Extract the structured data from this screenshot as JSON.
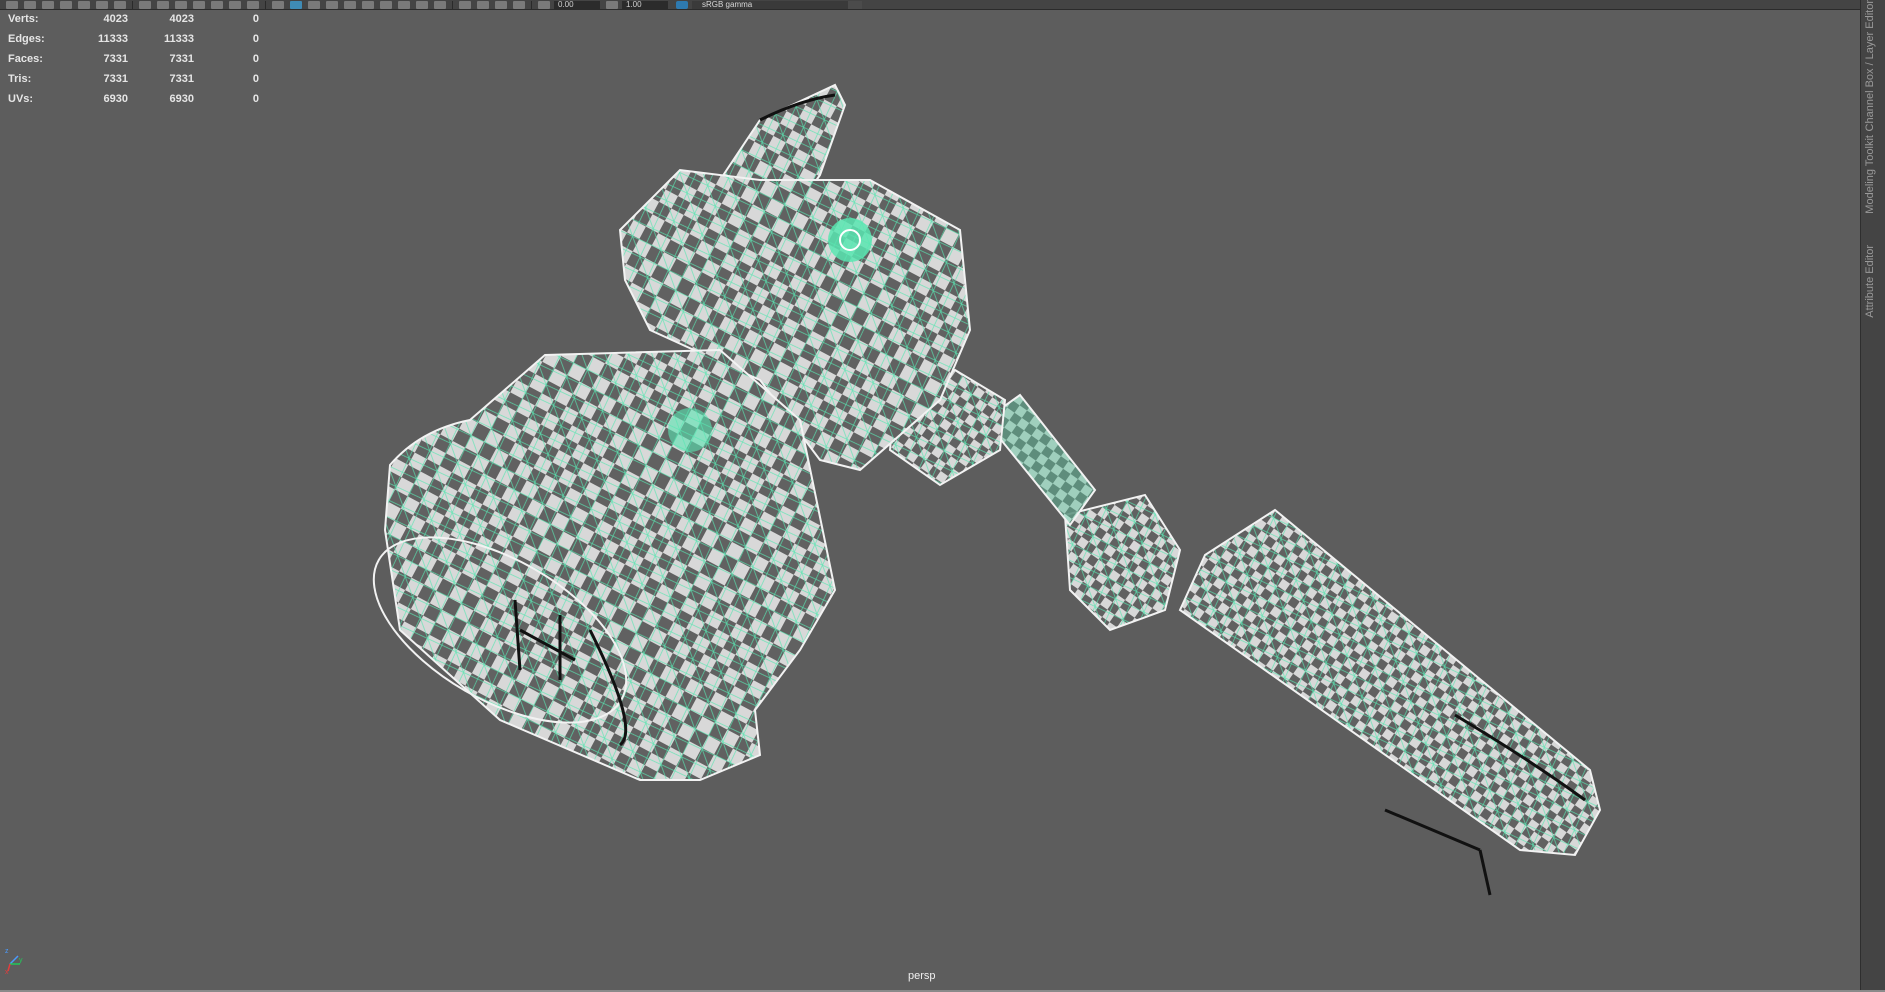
{
  "toolbar": {
    "exposure_value": "0.00",
    "gamma_value": "1.00",
    "color_space": "sRGB gamma"
  },
  "hud": {
    "rows": [
      {
        "label": "Verts:",
        "v1": "4023",
        "v2": "4023",
        "v3": "0"
      },
      {
        "label": "Edges:",
        "v1": "11333",
        "v2": "11333",
        "v3": "0"
      },
      {
        "label": "Faces:",
        "v1": "7331",
        "v2": "7331",
        "v3": "0"
      },
      {
        "label": "Tris:",
        "v1": "7331",
        "v2": "7331",
        "v3": "0"
      },
      {
        "label": "UVs:",
        "v1": "6930",
        "v2": "6930",
        "v3": "0"
      }
    ]
  },
  "viewport": {
    "camera": "persp",
    "background_color": "#5d5d5d",
    "wireframe_color": "#59e6b2",
    "checker_light": "#d8d8d8",
    "checker_dark": "#616161",
    "icon": "hammer-model"
  },
  "side_tabs": [
    "Channel Box / Layer Editor",
    "Modeling Toolkit",
    "Attribute Editor"
  ],
  "axis_gizmo": {
    "x": "x",
    "y": "y",
    "z": "z"
  }
}
